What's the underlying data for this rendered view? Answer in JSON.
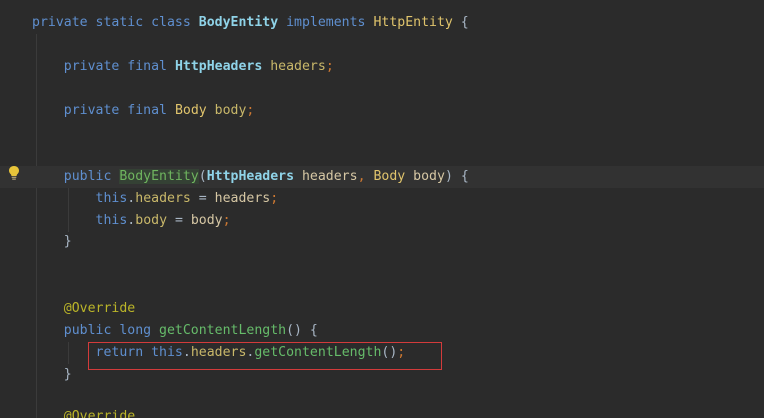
{
  "editor": {
    "lines": [
      {
        "tokens": [
          {
            "t": "private ",
            "c": "kw"
          },
          {
            "t": "static ",
            "c": "kw"
          },
          {
            "t": "class ",
            "c": "kw"
          },
          {
            "t": "BodyEntity",
            "c": "cls"
          },
          {
            "t": " implements ",
            "c": "kw"
          },
          {
            "t": "HttpEntity",
            "c": "type"
          },
          {
            "t": " {",
            "c": "punct"
          }
        ]
      },
      {
        "tokens": [
          {
            "t": "    ",
            "c": "punct"
          },
          {
            "t": "private ",
            "c": "kw"
          },
          {
            "t": "final ",
            "c": "kw"
          },
          {
            "t": "HttpHeaders",
            "c": "cls"
          },
          {
            "t": " headers",
            "c": "field"
          },
          {
            "t": ";",
            "c": "semi"
          }
        ]
      },
      {
        "tokens": [
          {
            "t": "    ",
            "c": "punct"
          },
          {
            "t": "private ",
            "c": "kw"
          },
          {
            "t": "final ",
            "c": "kw"
          },
          {
            "t": "Body",
            "c": "type"
          },
          {
            "t": " body",
            "c": "field"
          },
          {
            "t": ";",
            "c": "semi"
          }
        ]
      },
      {
        "tokens": [
          {
            "t": "    ",
            "c": "punct"
          },
          {
            "t": "public ",
            "c": "kw"
          },
          {
            "t": "BodyEntity",
            "c": "ctor hl"
          },
          {
            "t": "(",
            "c": "punct"
          },
          {
            "t": "HttpHeaders",
            "c": "cls"
          },
          {
            "t": " headers",
            "c": "param"
          },
          {
            "t": ", ",
            "c": "semi"
          },
          {
            "t": "Body",
            "c": "type"
          },
          {
            "t": " body",
            "c": "param"
          },
          {
            "t": ") {",
            "c": "punct"
          }
        ]
      },
      {
        "tokens": [
          {
            "t": "        ",
            "c": "punct"
          },
          {
            "t": "this",
            "c": "kw"
          },
          {
            "t": ".",
            "c": "punct"
          },
          {
            "t": "headers",
            "c": "field"
          },
          {
            "t": " = ",
            "c": "punct"
          },
          {
            "t": "headers",
            "c": "param"
          },
          {
            "t": ";",
            "c": "semi"
          }
        ]
      },
      {
        "tokens": [
          {
            "t": "        ",
            "c": "punct"
          },
          {
            "t": "this",
            "c": "kw"
          },
          {
            "t": ".",
            "c": "punct"
          },
          {
            "t": "body",
            "c": "field"
          },
          {
            "t": " = ",
            "c": "punct"
          },
          {
            "t": "body",
            "c": "param"
          },
          {
            "t": ";",
            "c": "semi"
          }
        ]
      },
      {
        "tokens": [
          {
            "t": "    }",
            "c": "punct"
          }
        ]
      },
      {
        "tokens": [
          {
            "t": "    ",
            "c": "punct"
          },
          {
            "t": "@Override",
            "c": "ann"
          }
        ]
      },
      {
        "tokens": [
          {
            "t": "    ",
            "c": "punct"
          },
          {
            "t": "public ",
            "c": "kw"
          },
          {
            "t": "long ",
            "c": "kw"
          },
          {
            "t": "getContentLength",
            "c": "method"
          },
          {
            "t": "() {",
            "c": "punct"
          }
        ]
      },
      {
        "tokens": [
          {
            "t": "        ",
            "c": "punct"
          },
          {
            "t": "return ",
            "c": "kw"
          },
          {
            "t": "this",
            "c": "kw"
          },
          {
            "t": ".",
            "c": "punct"
          },
          {
            "t": "headers",
            "c": "field"
          },
          {
            "t": ".",
            "c": "punct"
          },
          {
            "t": "getContentLength",
            "c": "method"
          },
          {
            "t": "()",
            "c": "punct"
          },
          {
            "t": ";",
            "c": "semi"
          }
        ]
      },
      {
        "tokens": [
          {
            "t": "    }",
            "c": "punct"
          }
        ]
      },
      {
        "tokens": [
          {
            "t": "    ",
            "c": "punct"
          },
          {
            "t": "@Override",
            "c": "ann"
          }
        ]
      }
    ]
  },
  "gutter": {
    "intention_icon": "lightbulb-icon"
  },
  "colors": {
    "background": "#2b2b2b",
    "current_line": "#323232",
    "highlight_box": "#d33b3b"
  }
}
